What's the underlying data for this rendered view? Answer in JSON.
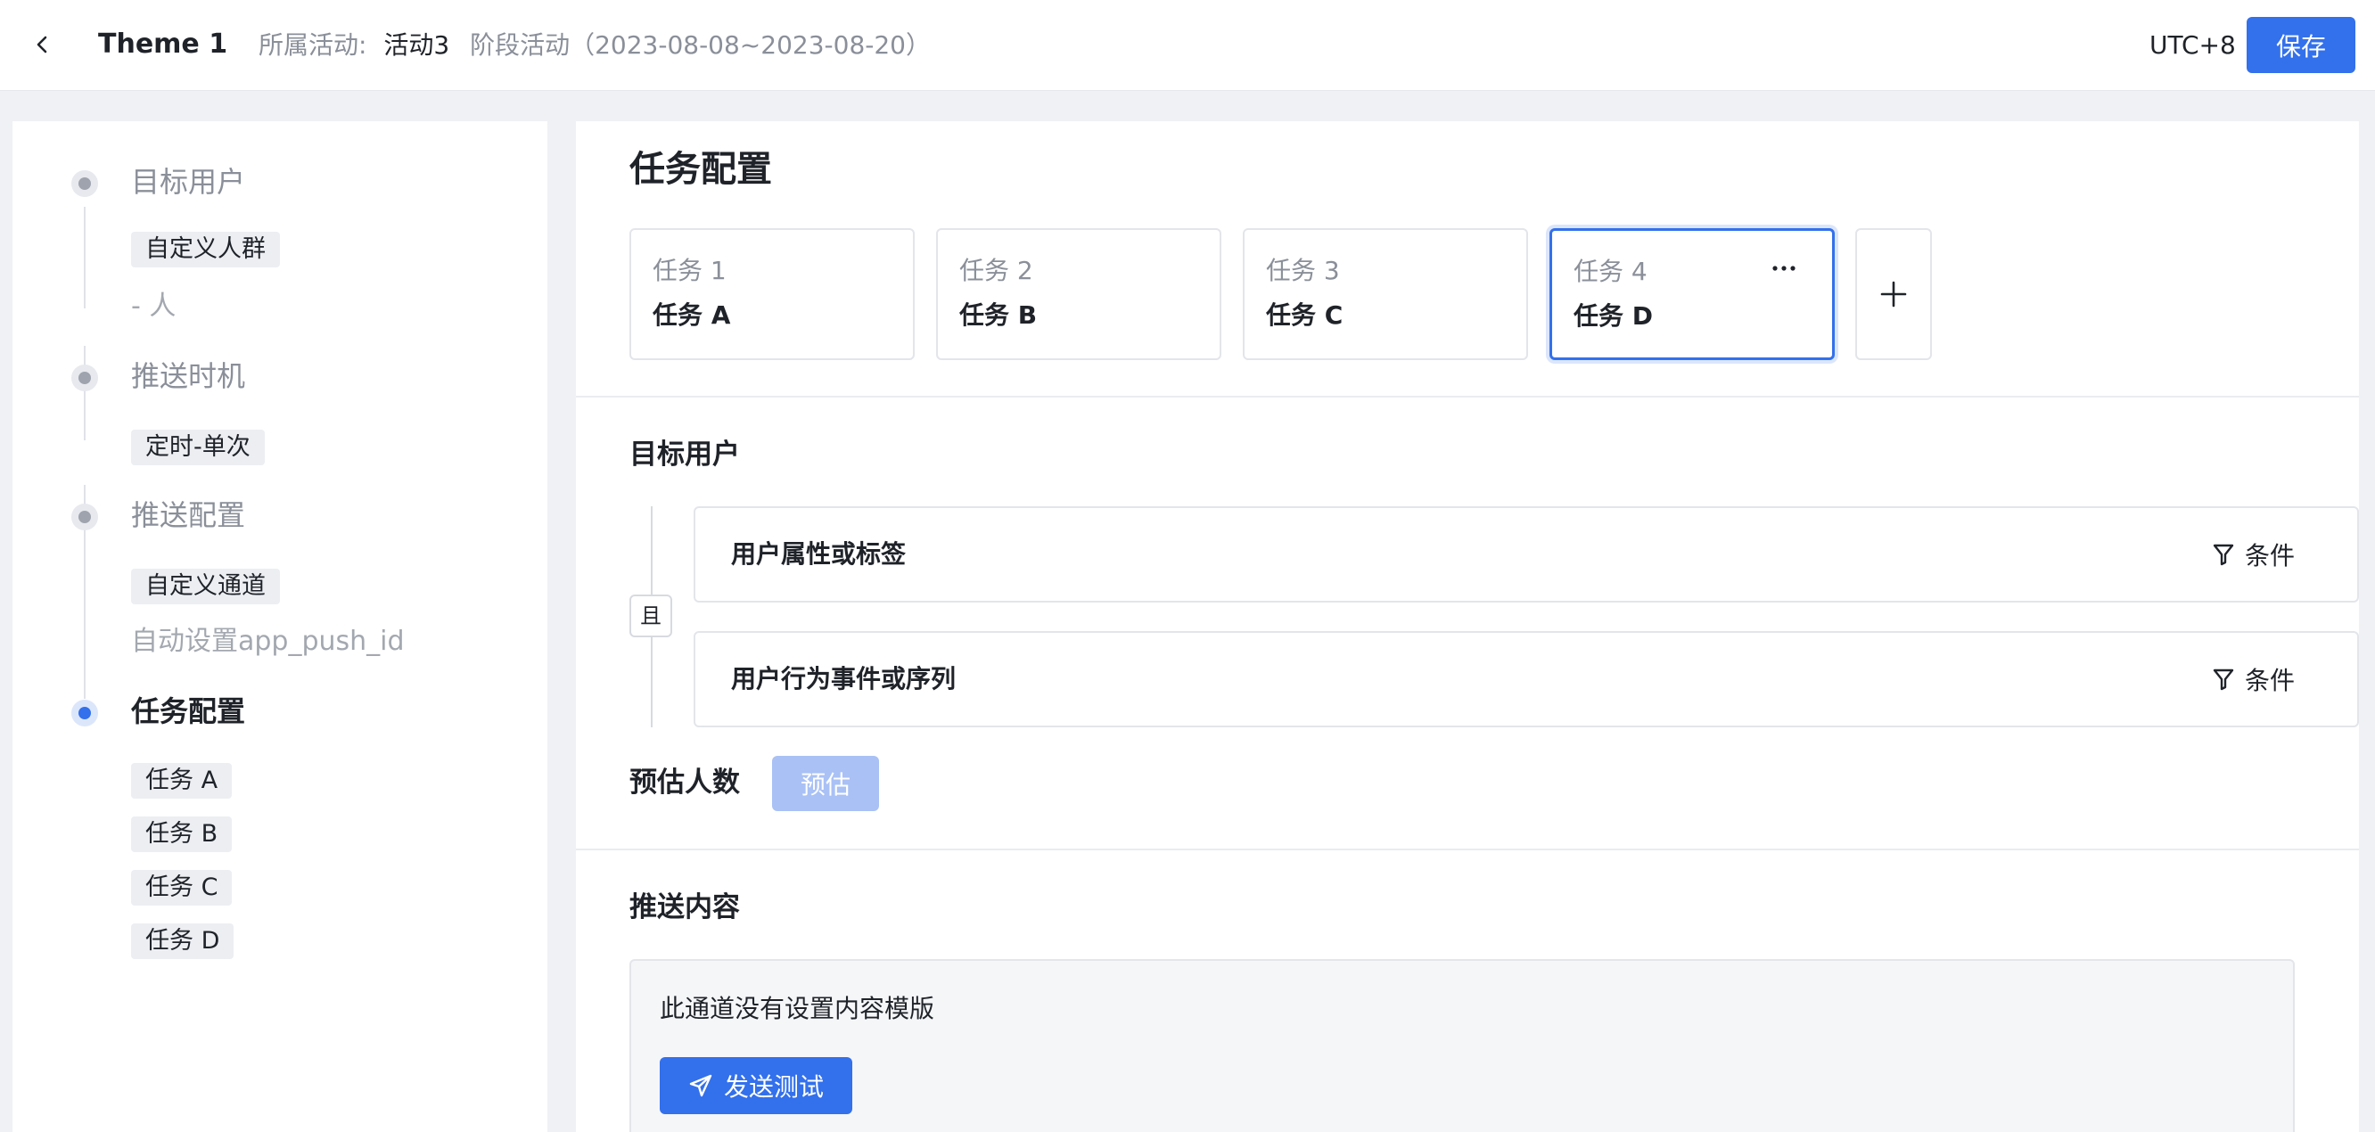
{
  "header": {
    "title": "Theme 1",
    "activity_label": "所属活动:",
    "activity_value": "活动3",
    "stage_text": "阶段活动（2023-08-08~2023-08-20）",
    "timezone": "UTC+8",
    "save_label": "保存"
  },
  "sidebar": {
    "steps": [
      {
        "title": "目标用户",
        "tags": [
          "自定义人群"
        ],
        "sub": "- 人"
      },
      {
        "title": "推送时机",
        "tags": [
          "定时-单次"
        ]
      },
      {
        "title": "推送配置",
        "tags": [
          "自定义通道"
        ],
        "sub": "自动设置app_push_id"
      },
      {
        "title": "任务配置",
        "tags": [
          "任务 A",
          "任务 B",
          "任务 C",
          "任务 D"
        ],
        "active": true
      }
    ]
  },
  "main": {
    "section_title": "任务配置",
    "tasks": [
      {
        "num": "任务 1",
        "name": "任务 A"
      },
      {
        "num": "任务 2",
        "name": "任务 B"
      },
      {
        "num": "任务 3",
        "name": "任务 C"
      },
      {
        "num": "任务 4",
        "name": "任务 D",
        "selected": true
      }
    ],
    "add_icon": "plus-icon",
    "more_icon": "ellipsis-icon",
    "target_users": {
      "title": "目标用户",
      "relation": "且",
      "rows": [
        {
          "label": "用户属性或标签",
          "button": "条件"
        },
        {
          "label": "用户行为事件或序列",
          "button": "条件"
        }
      ],
      "filter_icon": "filter-icon"
    },
    "estimate": {
      "label": "预估人数",
      "button": "预估"
    },
    "push_content": {
      "title": "推送内容",
      "message": "此通道没有设置内容模版",
      "test_button": "发送测试",
      "test_icon": "send-icon"
    }
  },
  "colors": {
    "accent": "#3370eb",
    "accent_disabled": "#a9c1f5",
    "muted_text": "#8a8f99"
  }
}
